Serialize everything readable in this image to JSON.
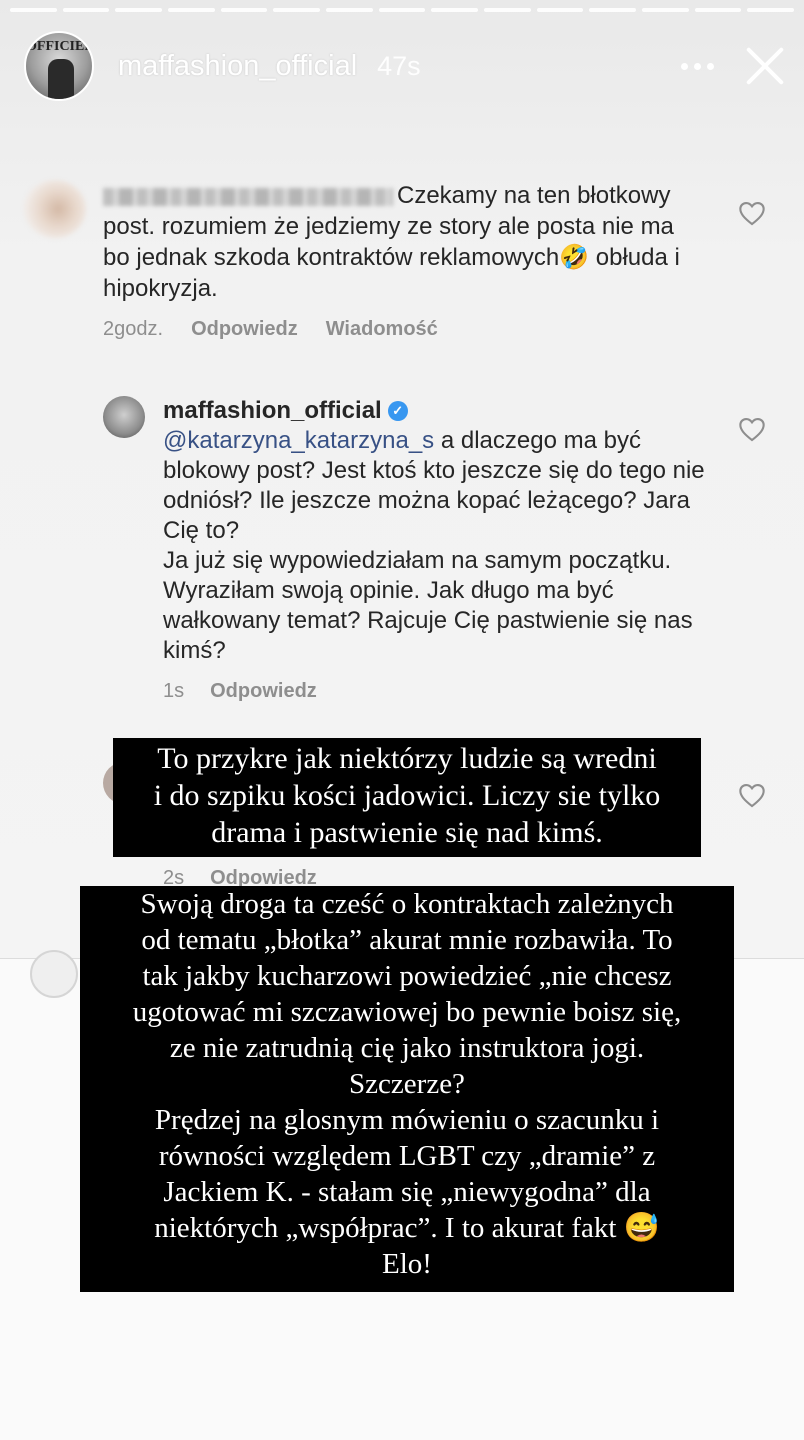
{
  "story": {
    "username": "maffashion_official",
    "elapsed": "47s",
    "avatar_text": "OFFICIEL",
    "segments": 15
  },
  "comment": {
    "text": "Czekamy na ten błotkowy post. rozumiem że jedziemy ze story ale posta nie ma bo jednak szkoda kontraktów reklamowych🤣 obłuda i hipokryzja.",
    "time": "2godz.",
    "reply_label": "Odpowiedz",
    "message_label": "Wiadomość"
  },
  "reply": {
    "username": "maffashion_official",
    "mention": "@katarzyna_katarzyna_s",
    "text1": " a dlaczego ma być blokowy post? Jest ktoś kto jeszcze się do tego nie odniósł? Ile jeszcze można kopać leżącego? Jara  Cię to?",
    "text2": "Ja już się wypowiedziałam na samym początku. Wyraziłam swoją opinie. Jak długo ma być wałkowany temat? Rajcuje Cię pastwienie się nas kimś?",
    "time": "1s",
    "reply_label": "Odpowiedz"
  },
  "hidden_comment": {
    "time": "2s",
    "reply_label": "Odpowiedz"
  },
  "caption1": "To przykre jak niektórzy ludzie są wredni\ni do szpiku kości jadowici. Liczy sie tylko\ndrama i pastwienie się nad kimś.",
  "caption2": "Swoją droga ta cześć o kontraktach zależnych\nod tematu „błotka” akurat mnie rozbawiła. To\ntak jakby kucharzowi powiedzieć „nie chcesz\nugotować mi szczawiowej bo pewnie boisz się,\nze nie zatrudnią cię jako instruktora jogi.\nSzczerze?\nPrędzej na glosnym mówieniu o szacunku i\nrówności względem LGBT czy „dramie” z\nJackiem K.   - stałam się „niewygodna” dla\nniektórych „współprac”. I to akurat fakt 😅\nElo!"
}
